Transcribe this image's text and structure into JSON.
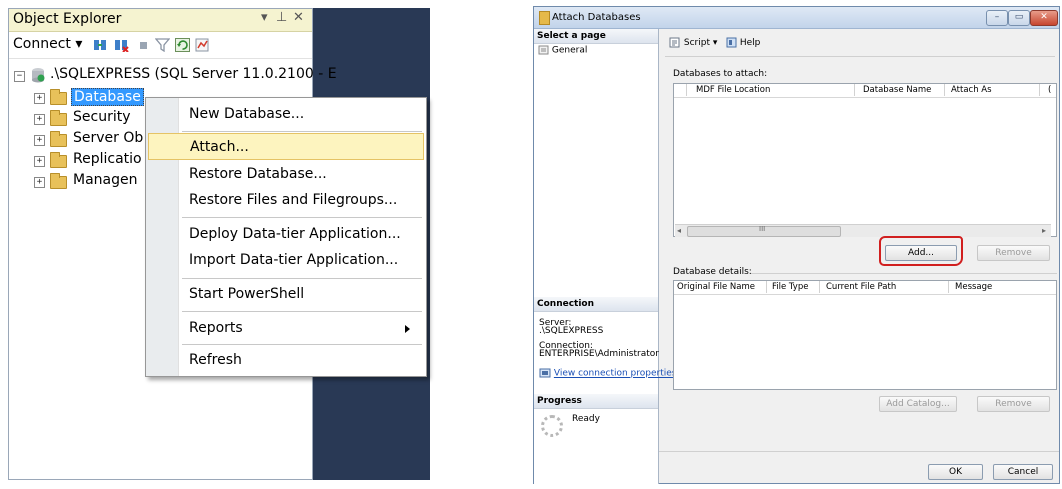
{
  "object_explorer": {
    "title": "Object Explorer",
    "title_controls": {
      "dropdown": "▾",
      "pin": "⊥",
      "close": "✕"
    },
    "toolbar": {
      "connect_label": "Connect ▾"
    },
    "tree": {
      "server": ".\\SQLEXPRESS (SQL Server 11.0.2100 - E",
      "nodes": [
        "Database",
        "Security",
        "Server Ob",
        "Replicatio",
        "Managen"
      ]
    },
    "context_menu": {
      "items": [
        "New Database...",
        "Attach...",
        "Restore Database...",
        "Restore Files and Filegroups...",
        "Deploy Data-tier Application...",
        "Import Data-tier Application...",
        "Start PowerShell",
        "Reports",
        "Refresh"
      ],
      "highlighted": "Attach..."
    }
  },
  "attach_dialog": {
    "title": "Attach Databases",
    "window_buttons": {
      "minimize": "–",
      "maximize": "▭",
      "close": "✕"
    },
    "select_page": {
      "header": "Select a page",
      "pages": [
        "General"
      ]
    },
    "toolbar": {
      "script": "Script",
      "help": "Help"
    },
    "databases_to_attach": {
      "label": "Databases to attach:",
      "columns": [
        "MDF File Location",
        "Database Name",
        "Attach As",
        "("
      ],
      "scroll_mark": "III",
      "buttons": {
        "add": "Add...",
        "remove": "Remove"
      }
    },
    "database_details": {
      "label": "Database details:",
      "columns": [
        "Original File Name",
        "File Type",
        "Current File Path",
        "Message"
      ],
      "buttons": {
        "add_catalog": "Add Catalog...",
        "remove": "Remove"
      }
    },
    "connection": {
      "header": "Connection",
      "server_label": "Server:",
      "server": ".\\SQLEXPRESS",
      "connection_label": "Connection:",
      "connection": "ENTERPRISE\\Administrator",
      "view_link": "View connection properties"
    },
    "progress": {
      "header": "Progress",
      "status": "Ready"
    },
    "footer": {
      "ok": "OK",
      "cancel": "Cancel"
    }
  }
}
